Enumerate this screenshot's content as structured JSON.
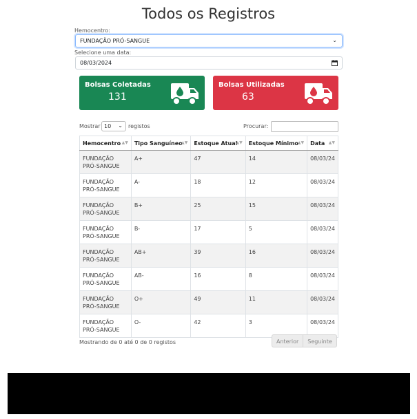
{
  "page": {
    "title": "Todos os Registros"
  },
  "filters": {
    "hemocentro_label": "Hemocentro:",
    "hemocentro_value": "FUNDAÇÃO PRÓ-SANGUE",
    "date_label": "Selecione uma data:",
    "date_value": "08/03/2024"
  },
  "cards": {
    "coletadas": {
      "title": "Bolsas Coletadas",
      "value": "131",
      "color": "#198754",
      "icon": "blood-truck-icon"
    },
    "utilizadas": {
      "title": "Bolsas Utilizadas",
      "value": "63",
      "color": "#dc3545",
      "icon": "blood-truck-icon"
    }
  },
  "table_controls": {
    "show_label": "Mostrar",
    "length_value": "10",
    "records_label": "registos",
    "search_label": "Procurar:"
  },
  "table": {
    "headers": [
      "Hemocentro",
      "Tipo Sanguíneo",
      "Estoque Atual",
      "Estoque Mínimo",
      "Data"
    ],
    "rows": [
      {
        "hemocentro": "FUNDAÇÃO PRÓ-SANGUE",
        "tipo": "A+",
        "atual": "47",
        "minimo": "14",
        "data": "08/03/24"
      },
      {
        "hemocentro": "FUNDAÇÃO PRÓ-SANGUE",
        "tipo": "A-",
        "atual": "18",
        "minimo": "12",
        "data": "08/03/24"
      },
      {
        "hemocentro": "FUNDAÇÃO PRÓ-SANGUE",
        "tipo": "B+",
        "atual": "25",
        "minimo": "15",
        "data": "08/03/24"
      },
      {
        "hemocentro": "FUNDAÇÃO PRÓ-SANGUE",
        "tipo": "B-",
        "atual": "17",
        "minimo": "5",
        "data": "08/03/24"
      },
      {
        "hemocentro": "FUNDAÇÃO PRÓ-SANGUE",
        "tipo": "AB+",
        "atual": "39",
        "minimo": "16",
        "data": "08/03/24"
      },
      {
        "hemocentro": "FUNDAÇÃO PRÓ-SANGUE",
        "tipo": "AB-",
        "atual": "16",
        "minimo": "8",
        "data": "08/03/24"
      },
      {
        "hemocentro": "FUNDAÇÃO PRÓ-SANGUE",
        "tipo": "O+",
        "atual": "49",
        "minimo": "11",
        "data": "08/03/24"
      },
      {
        "hemocentro": "FUNDAÇÃO PRÓ-SANGUE",
        "tipo": "O-",
        "atual": "42",
        "minimo": "3",
        "data": "08/03/24"
      }
    ]
  },
  "footer": {
    "info": "Mostrando de 0 até 0 de 0 registos",
    "prev": "Anterior",
    "next": "Seguinte"
  }
}
